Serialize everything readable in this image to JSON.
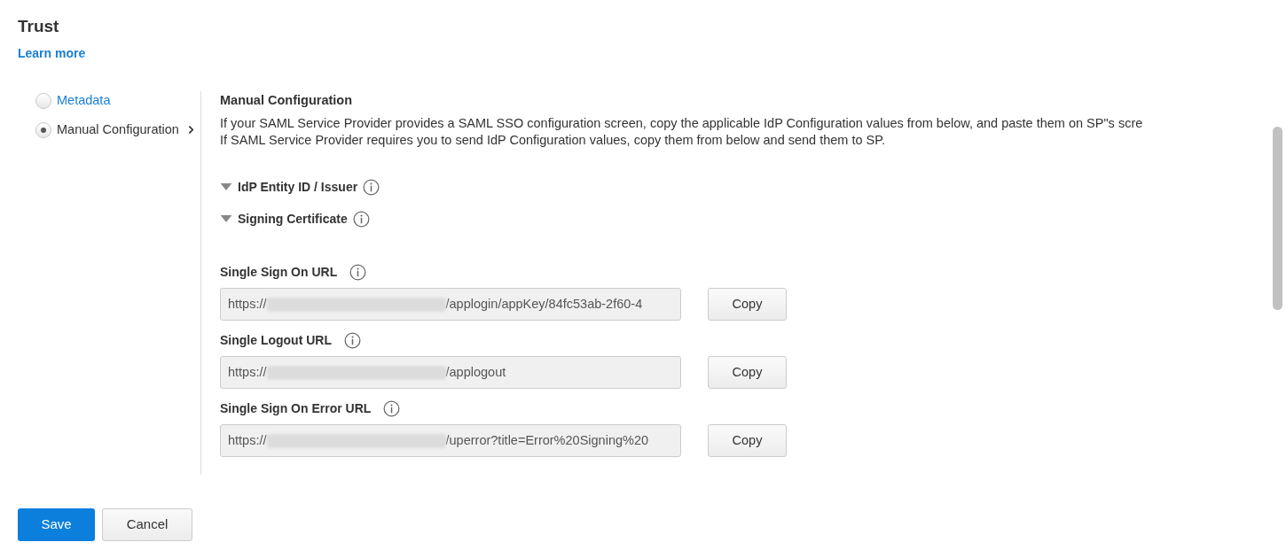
{
  "page": {
    "title": "Trust",
    "learn_more": "Learn more"
  },
  "options": [
    {
      "label": "Metadata",
      "selected": false
    },
    {
      "label": "Manual Configuration",
      "selected": true
    }
  ],
  "section": {
    "title": "Manual Configuration",
    "description": [
      "If your SAML Service Provider provides a SAML SSO configuration screen, copy the applicable IdP Configuration values from below, and paste them on SP\"s scre",
      "If SAML Service Provider requires you to send IdP Configuration values, copy them from below and send them to SP."
    ]
  },
  "collapsibles": [
    {
      "label": "IdP Entity ID / Issuer"
    },
    {
      "label": "Signing Certificate"
    }
  ],
  "url_fields": [
    {
      "label": "Single Sign On URL",
      "prefix": "https://",
      "suffix": "/applogin/appKey/84fc53ab-2f60-4",
      "button": "Copy"
    },
    {
      "label": "Single Logout URL",
      "prefix": "https://",
      "suffix": "/applogout",
      "button": "Copy"
    },
    {
      "label": "Single Sign On Error URL",
      "prefix": "https://",
      "suffix": "/uperror?title=Error%20Signing%20",
      "button": "Copy"
    }
  ],
  "buttons": [
    {
      "label": "Save",
      "kind": "primary"
    },
    {
      "label": "Cancel",
      "kind": "secondary"
    }
  ]
}
